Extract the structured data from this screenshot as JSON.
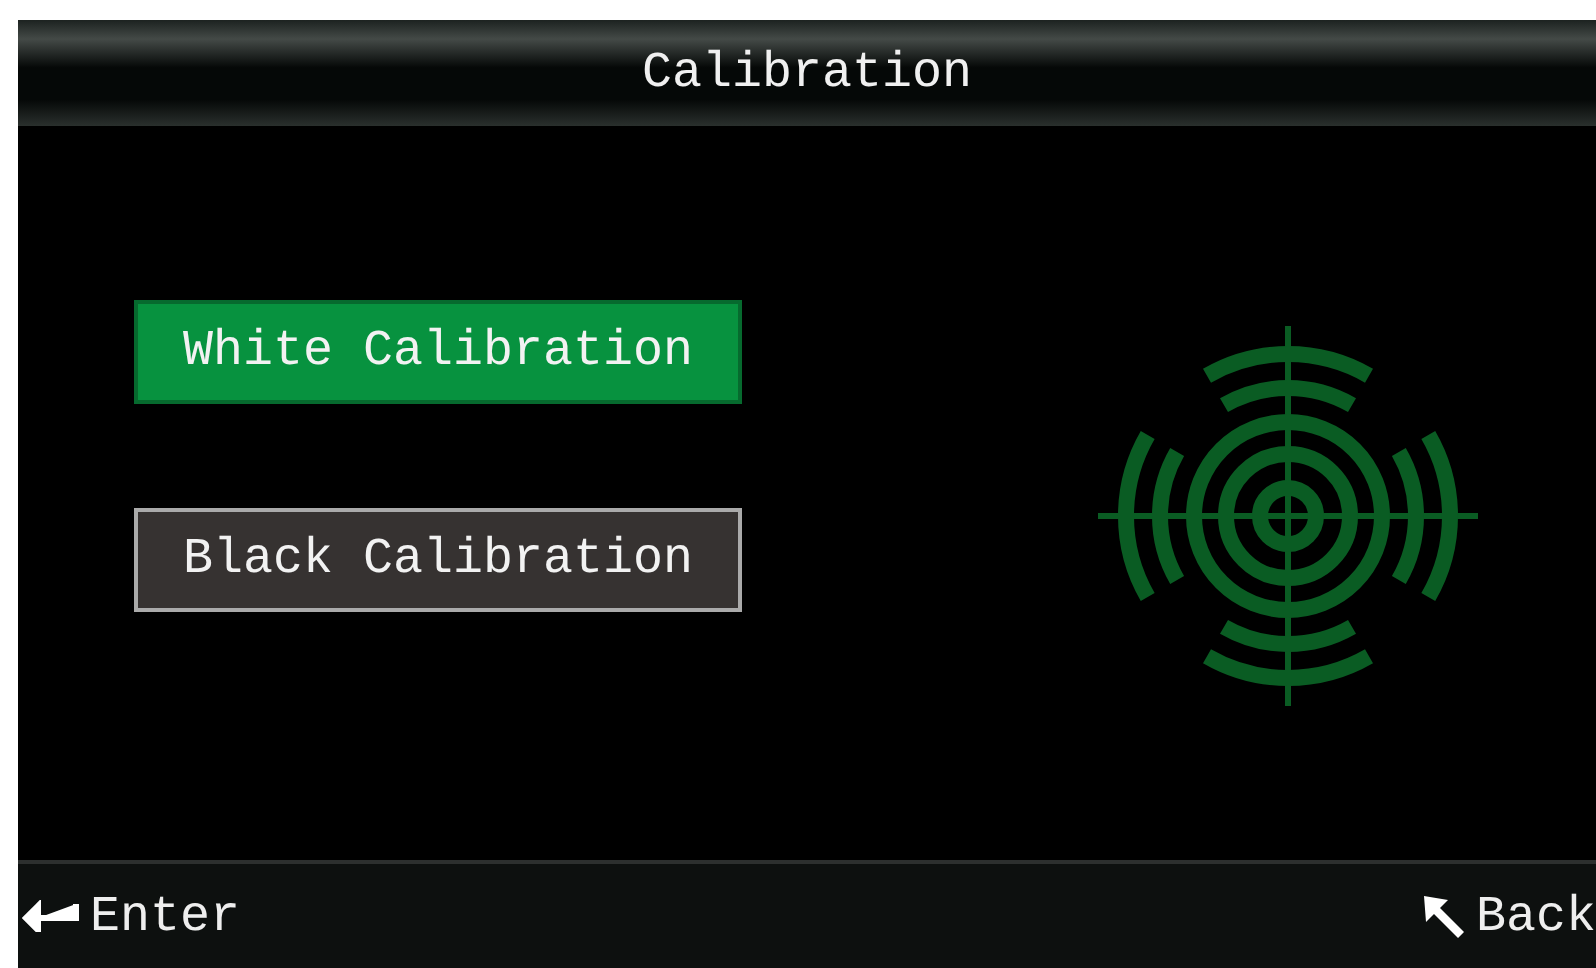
{
  "header": {
    "title": "Calibration"
  },
  "options": [
    {
      "label": "White Calibration",
      "selected": true
    },
    {
      "label": "Black Calibration",
      "selected": false
    }
  ],
  "footer": {
    "enter": "Enter",
    "back": "Back"
  }
}
